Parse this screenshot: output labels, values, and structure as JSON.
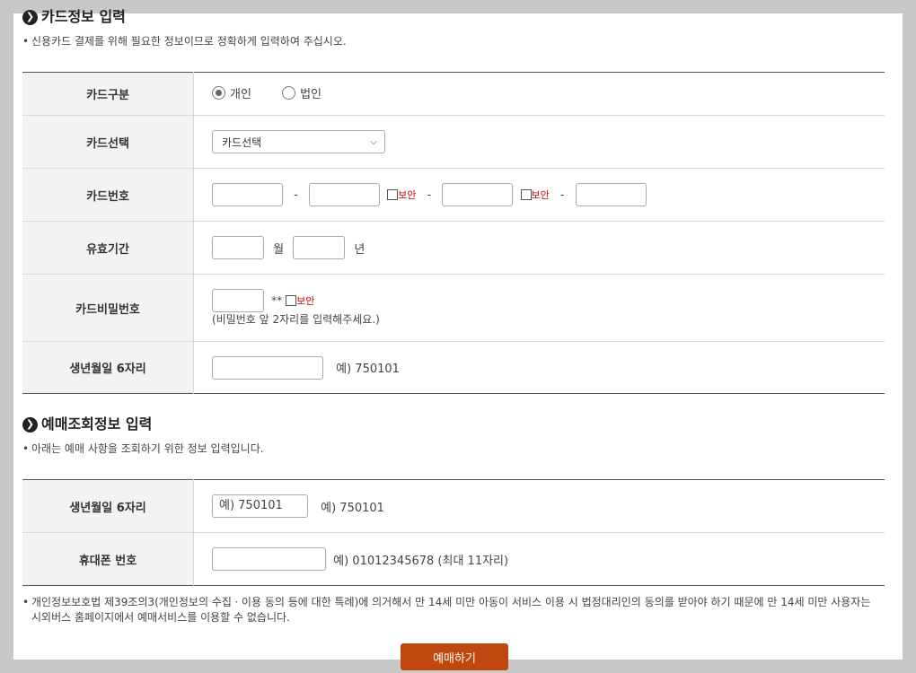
{
  "card_section": {
    "title": "카드정보 입력",
    "description": "신용카드 결제를 위해 필요한 정보이므로 정확하게 입력하여 주십시오.",
    "rows": {
      "card_type": {
        "label": "카드구분",
        "option_personal": "개인",
        "option_corporate": "법인",
        "selected": "개인"
      },
      "card_select": {
        "label": "카드선택",
        "selected": "카드선택"
      },
      "card_number": {
        "label": "카드번호",
        "separator": "-",
        "secure_label": "보안"
      },
      "expiry": {
        "label": "유효기간",
        "month_unit": "월",
        "year_unit": "년"
      },
      "password": {
        "label": "카드비밀번호",
        "mask": "**",
        "secure_label": "보안",
        "hint": "(비밀번호 앞 2자리를 입력해주세요.)"
      },
      "birth": {
        "label": "생년월일 6자리",
        "example": "예) 750101"
      }
    }
  },
  "inquiry_section": {
    "title": "예매조회정보 입력",
    "description": "아래는 예매 사항을 조회하기 위한 정보 입력입니다.",
    "rows": {
      "birth": {
        "label": "생년월일 6자리",
        "placeholder": "예) 750101",
        "example": "예) 750101"
      },
      "phone": {
        "label": "휴대폰 번호",
        "example": "예) 01012345678 (최대 11자리)"
      }
    }
  },
  "notice": "개인정보보호법 제39조의3(개인정보의 수집ㆍ이용 동의 등에 대한 특례)에 의거해서 만 14세 미만 아동이 서비스 이용 시 법정대리인의 동의를 받아야 하기 때문에 만 14세 미만 사용자는 시외버스 홈페이지에서 예매서비스를 이용할 수 없습니다.",
  "bullet_char": "•",
  "submit_label": "예매하기",
  "colors": {
    "accent": "#c0480e",
    "secure": "#cc0000",
    "header_bg": "#f3f3f3",
    "page_bg": "#c8c8c8"
  }
}
